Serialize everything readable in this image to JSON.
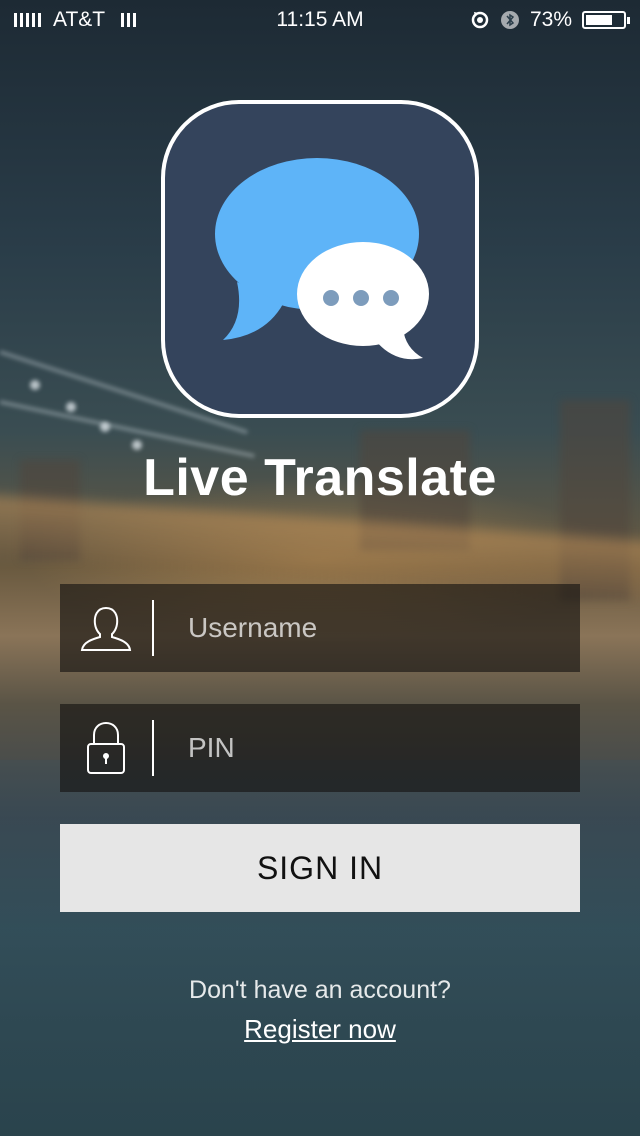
{
  "status_bar": {
    "carrier": "AT&T",
    "time": "11:15 AM",
    "battery_percent": "73%",
    "battery_level": 0.73,
    "icons": [
      "signal-icon",
      "wifi-icon",
      "rotation-lock-icon",
      "bluetooth-icon",
      "battery-icon"
    ]
  },
  "app": {
    "title": "Live Translate",
    "icon": "chat-bubbles-icon"
  },
  "login": {
    "username_placeholder": "Username",
    "pin_placeholder": "PIN",
    "username_icon": "user-icon",
    "pin_icon": "lock-icon",
    "sign_in_label": "SIGN IN"
  },
  "footer": {
    "prompt": "Don't have an account?",
    "register_label": "Register now"
  },
  "colors": {
    "icon_background": "#34445c",
    "large_bubble": "#5eb4f8",
    "small_bubble": "#ffffff",
    "dots": "#7d9cbc",
    "button_background": "#e6e6e6",
    "field_background": "rgba(20,18,16,0.62)"
  }
}
